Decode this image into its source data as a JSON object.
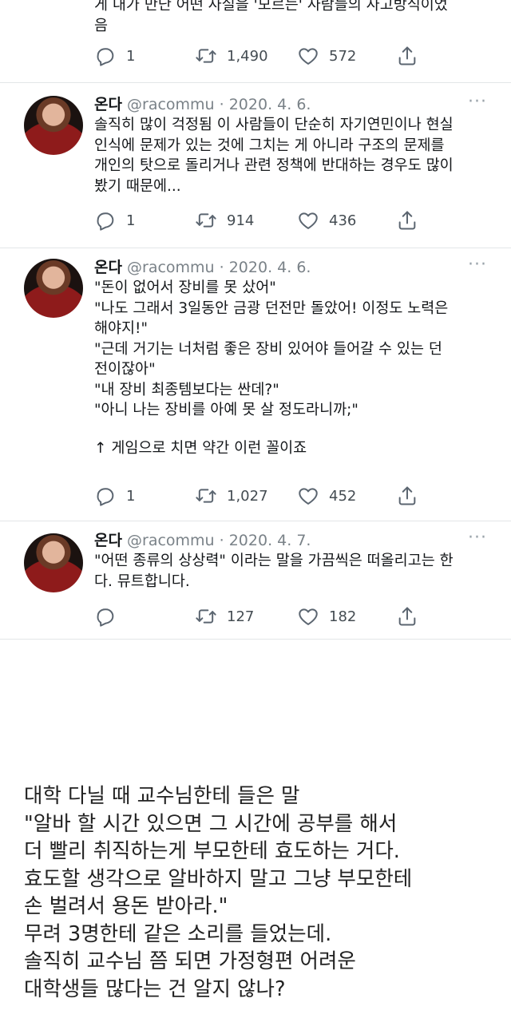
{
  "top_tweet": {
    "lines": [
      "게 내가 만난 어떤 사실을 '모르는' 사람들의 사고방식이었",
      "음"
    ],
    "replies": "1",
    "retweets": "1,490",
    "likes": "572"
  },
  "tweets": [
    {
      "name": "온다",
      "handle": "@racommu · 2020. 4. 6.",
      "more": "···",
      "lines": [
        "솔직히 많이 걱정됨 이 사람들이 단순히 자기연민이나 현실",
        "인식에 문제가 있는 것에 그치는 게 아니라 구조의 문제를",
        "개인의 탓으로 돌리거나 관련 정책에 반대하는 경우도 많이",
        "봤기 때문에..."
      ],
      "replies": "1",
      "retweets": "914",
      "likes": "436"
    },
    {
      "name": "온다",
      "handle": "@racommu · 2020. 4. 6.",
      "more": "···",
      "lines": [
        "\"돈이 없어서 장비를 못 샀어\"",
        "\"나도 그래서 3일동안 금광 던전만 돌았어! 이정도 노력은",
        "해야지!\"",
        "\"근데 거기는 너처럼 좋은 장비 있어야 들어갈 수 있는 던",
        "전이잖아\"",
        "\"내 장비 최종템보다는 싼데?\"",
        "\"아니 나는 장비를 아예 못 살 정도라니까;\""
      ],
      "note": "↑ 게임으로 치면 약간 이런 꼴이죠",
      "replies": "1",
      "retweets": "1,027",
      "likes": "452"
    },
    {
      "name": "온다",
      "handle": "@racommu · 2020. 4. 7.",
      "more": "···",
      "lines": [
        "\"어떤 종류의 상상력\" 이라는 말을 가끔씩은 떠올리고는 한",
        "다. 뮤트합니다."
      ],
      "replies": "",
      "retweets": "127",
      "likes": "182"
    }
  ],
  "post": {
    "lines": [
      "대학 다닐 때 교수님한테 들은 말",
      "\"알바 할 시간 있으면 그 시간에 공부를 해서",
      "더 빨리 취직하는게 부모한테 효도하는 거다.",
      "효도할 생각으로 알바하지 말고 그냥 부모한테",
      "손 벌려서 용돈 받아라.\"",
      "무려 3명한테 같은 소리를 들었는데.",
      "솔직히 교수님 쯤 되면 가정형편 어려운",
      "대학생들 많다는 건 알지 않나?"
    ]
  },
  "icons": [
    "reply-icon",
    "retweet-icon",
    "like-icon",
    "share-icon",
    "more-icon"
  ],
  "colors": {
    "text": "#14171a",
    "secondary": "#7a8288",
    "icon": "#5b6570",
    "divider": "#e3e6e8"
  }
}
